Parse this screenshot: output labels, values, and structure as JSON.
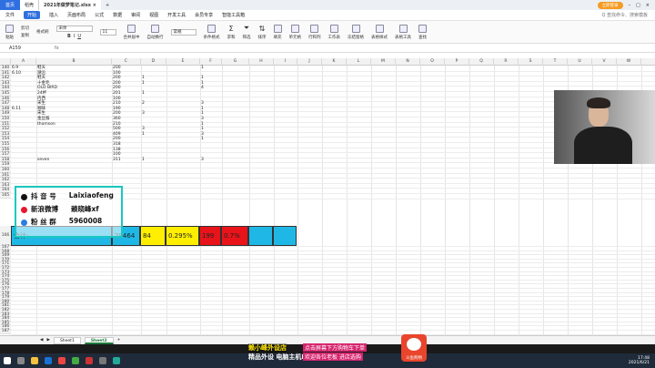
{
  "titlebar": {
    "home_tab": "首页",
    "tab1": "稻壳",
    "tab2": "2021年做梦笔记.xlsx",
    "login": "立即登录"
  },
  "menu": [
    "文件",
    "开始",
    "插入",
    "页面布局",
    "公式",
    "数据",
    "审阅",
    "视图",
    "开发工具",
    "会员专享",
    "智能工具箱"
  ],
  "search": "Q 查找命令、搜索模板",
  "ribbon": {
    "paste": "粘贴",
    "cut": "剪切",
    "copy": "复制",
    "brush": "格式刷",
    "font": "宋体",
    "size": "11",
    "merge": "合并居中",
    "wrap": "自动换行",
    "number_fmt": "常规",
    "cond_fmt": "条件格式",
    "sum": "求和",
    "filter": "筛选",
    "sort": "排序",
    "fill": "填充",
    "cell": "单元格",
    "rowcol": "行和列",
    "sheet": "工作表",
    "freeze": "冻结窗格",
    "tablestyle": "表格样式",
    "table_tools": "表格工具",
    "find": "查找"
  },
  "formula": {
    "namebox": "A159",
    "fx": "fx"
  },
  "columns": [
    "A",
    "B",
    "C",
    "D",
    "E",
    "F",
    "G",
    "H",
    "I",
    "J",
    "K",
    "L",
    "M",
    "N",
    "O",
    "P",
    "Q",
    "R",
    "S",
    "T",
    "U",
    "V",
    "W"
  ],
  "rows_top": [
    {
      "num": "140",
      "a": "6.9",
      "b": "鞋天",
      "c": "200",
      "d": "",
      "f": "1"
    },
    {
      "num": "141",
      "a": "6.10",
      "b": "潮沿",
      "c": "100",
      "d": "",
      "f": ""
    },
    {
      "num": "142",
      "a": "",
      "b": "鞋天",
      "c": "200",
      "d": "1",
      "f": "1"
    },
    {
      "num": "143",
      "a": "",
      "b": "十金毛",
      "c": "200",
      "d": "1",
      "f": "1"
    },
    {
      "num": "144",
      "a": "",
      "b": "OLD BIRD",
      "c": "200",
      "d": "",
      "f": "4"
    },
    {
      "num": "145",
      "a": "",
      "b": "24杯",
      "c": "201",
      "d": "1",
      "f": ""
    },
    {
      "num": "146",
      "a": "",
      "b": "内西",
      "c": "100",
      "d": "",
      "f": ""
    },
    {
      "num": "147",
      "a": "",
      "b": "宋生",
      "c": "210",
      "d": "2",
      "f": "3"
    },
    {
      "num": "148",
      "a": "6.11",
      "b": "咖啡",
      "c": "190",
      "d": "",
      "f": "1"
    },
    {
      "num": "149",
      "a": "",
      "b": "宋生",
      "c": "200",
      "d": "3",
      "f": "1"
    },
    {
      "num": "150",
      "a": "",
      "b": "金丝猴",
      "c": "360",
      "d": "",
      "f": "3"
    },
    {
      "num": "151",
      "a": "",
      "b": "thomson",
      "c": "210",
      "d": "",
      "f": "1"
    },
    {
      "num": "152",
      "a": "",
      "b": "",
      "c": "500",
      "d": "3",
      "f": "1"
    },
    {
      "num": "153",
      "a": "",
      "b": "",
      "c": "409",
      "d": "1",
      "f": "3"
    },
    {
      "num": "154",
      "a": "",
      "b": "",
      "c": "200",
      "d": "",
      "f": "1"
    },
    {
      "num": "155",
      "a": "",
      "b": "",
      "c": "318",
      "d": "",
      "f": ""
    },
    {
      "num": "156",
      "a": "",
      "b": "",
      "c": "138",
      "d": "",
      "f": ""
    },
    {
      "num": "157",
      "a": "",
      "b": "",
      "c": "100",
      "d": "",
      "f": ""
    },
    {
      "num": "158",
      "a": "",
      "b": "seven",
      "c": "311",
      "d": "1",
      "f": "3"
    }
  ],
  "rows_mid": [
    "159",
    "160",
    "161",
    "162",
    "163",
    "164",
    "165"
  ],
  "sum_row": {
    "num": "166",
    "label": "合计:",
    "c": "28464",
    "d": "84",
    "e": "0.295%",
    "f": "199",
    "g": "0.7%"
  },
  "rows_bottom": [
    "167",
    "168",
    "169",
    "170",
    "171",
    "172",
    "173",
    "174",
    "175",
    "176",
    "177",
    "178",
    "179",
    "180",
    "181",
    "182",
    "183",
    "184",
    "185",
    "186",
    "187"
  ],
  "overlay": {
    "row1_a": "抖 音 号",
    "row1_b": "Laixiaofeng",
    "row2_a": "新浪微博",
    "row2_b": "赖晓峰xf",
    "row3_a": "粉 丝 群",
    "row3_b": "5960008"
  },
  "sheet_tabs": [
    "Sheet1",
    "Sheet2"
  ],
  "banner": {
    "line1a": "赖小峰外设店",
    "line1b": "点击屏幕下方购物车下单",
    "line2a": "精品外设 电脑主机DIY",
    "line2b": "欢迎各位老板 进店选购",
    "logo": "斗鱼购物"
  },
  "clock": {
    "time": "17:48",
    "date": "2021/6/21"
  },
  "colors": {
    "sum_blue": "#1fb8e6",
    "sum_yellow": "#ffee00",
    "sum_red": "#e8141a",
    "overlay_border": "#19c8c0"
  }
}
